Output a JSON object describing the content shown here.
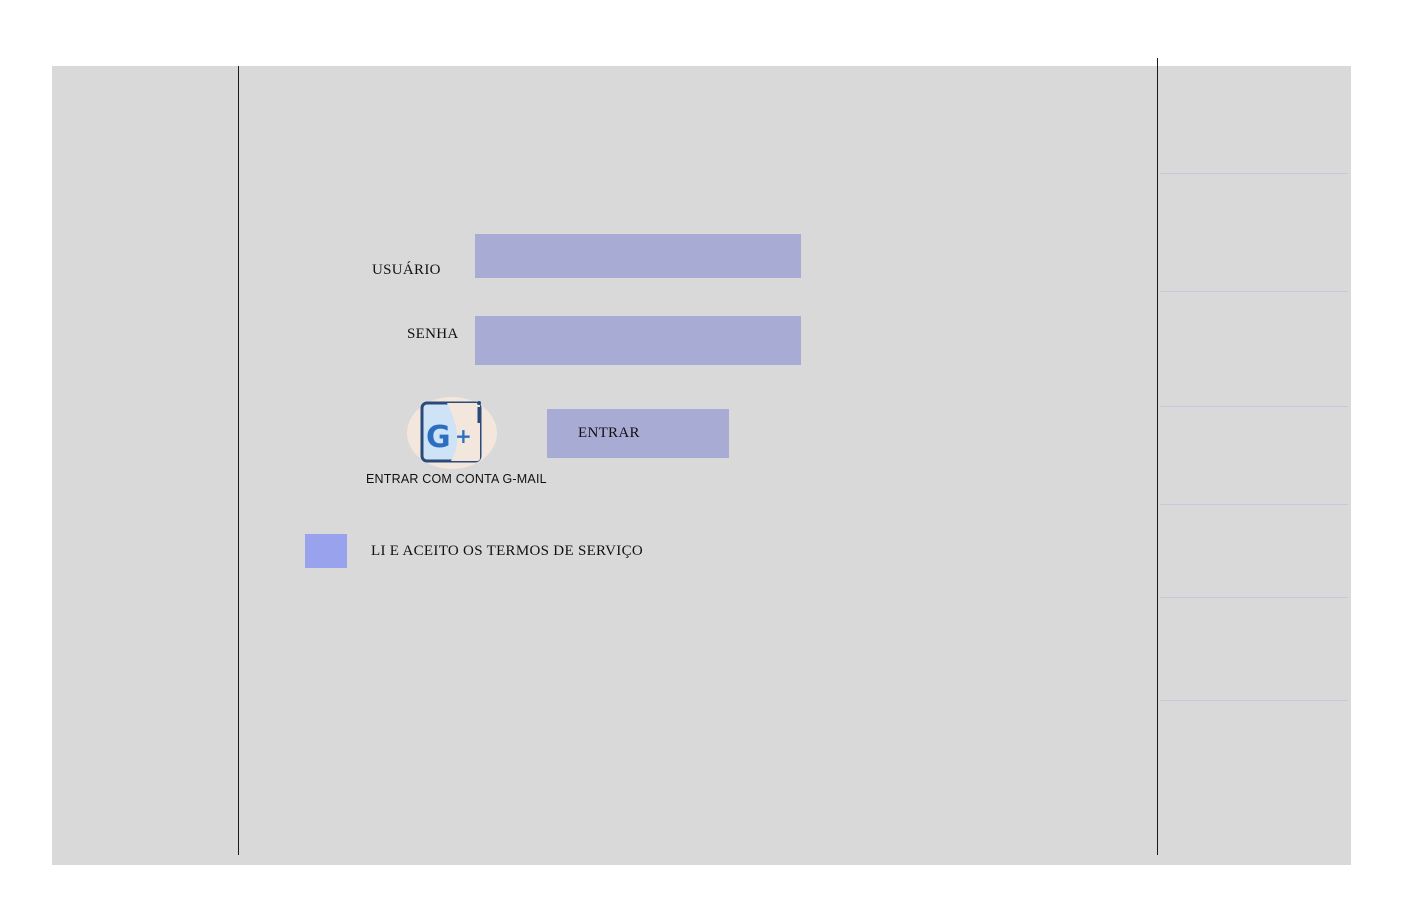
{
  "login": {
    "usuario_label": "USUÁRIO",
    "usuario_value": "",
    "senha_label": "SENHA",
    "senha_value": "",
    "entrar_button": "ENTRAR",
    "google_caption": "ENTRAR COM CONTA G-MAIL",
    "terms_label": "LI E ACEITO OS TERMOS DE SERVIÇO",
    "terms_checked": false
  },
  "colors": {
    "background": "#d9d9d9",
    "field_fill": "#a8abd4",
    "checkbox_fill": "#99a2ec",
    "google_circle": "#f3e6dc"
  },
  "icons": {
    "google": "google-plus-icon"
  }
}
